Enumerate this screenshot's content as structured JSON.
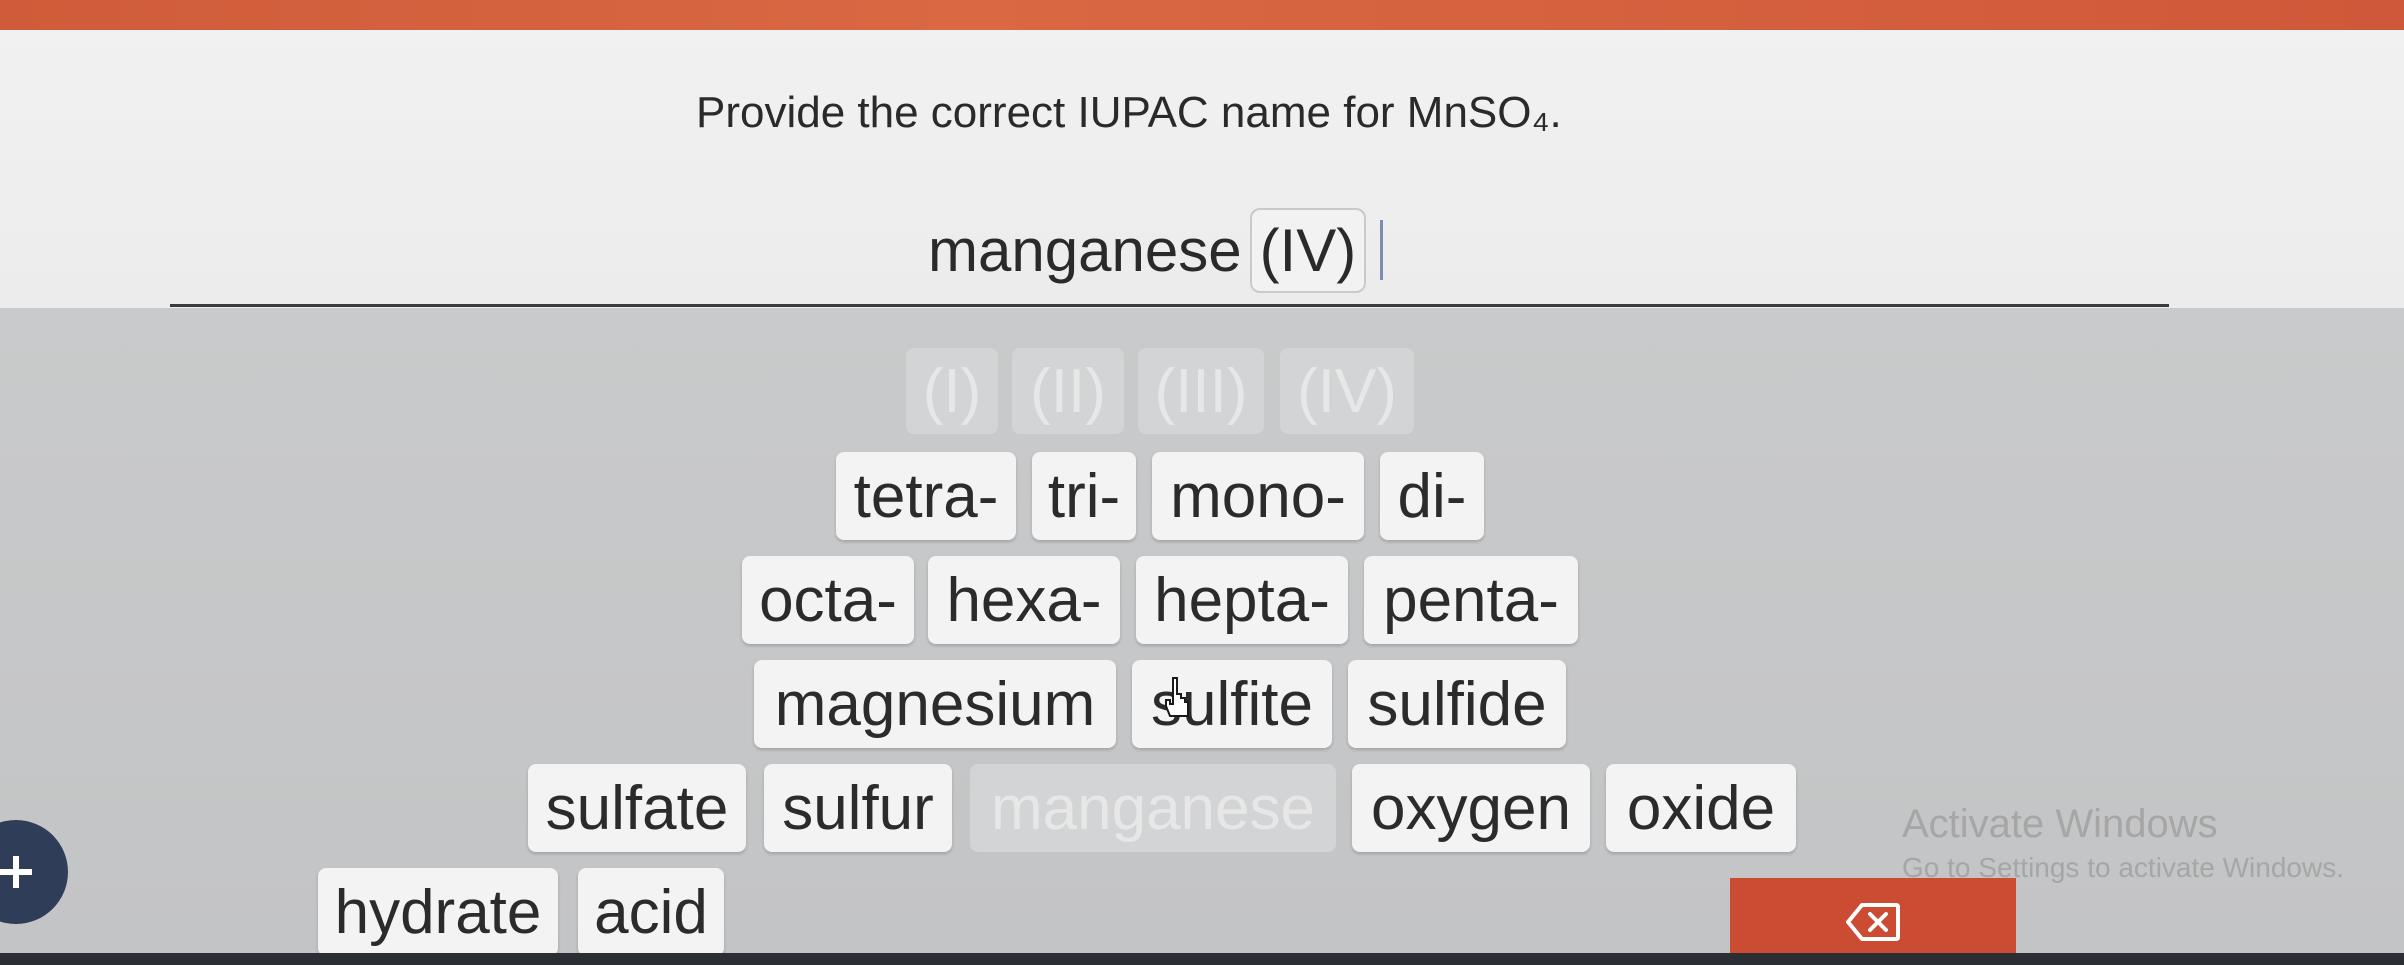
{
  "question": {
    "text": "Provide the correct IUPAC name for MnSO₄."
  },
  "answer": {
    "word": "manganese",
    "chip": "(IV)"
  },
  "roman_row": [
    "(I)",
    "(II)",
    "(III)",
    "(IV)"
  ],
  "prefix_row1": [
    "tetra-",
    "tri-",
    "mono-",
    "di-"
  ],
  "prefix_row2": [
    "octa-",
    "hexa-",
    "hepta-",
    "penta-"
  ],
  "word_row1": [
    "magnesium",
    "sulfite",
    "sulfide"
  ],
  "word_row2": [
    "sulfate",
    "sulfur",
    "manganese",
    "oxygen",
    "oxide"
  ],
  "word_row3": [
    "hydrate",
    "acid"
  ],
  "disabled_keys": [
    "(I)",
    "(II)",
    "(III)",
    "(IV)",
    "manganese"
  ],
  "watermark": {
    "title": "Activate Windows",
    "subtitle": "Go to Settings to activate Windows."
  },
  "icons": {
    "add": "plus-icon",
    "delete": "backspace-icon",
    "cursor": "hand-pointer-icon"
  },
  "colors": {
    "accent": "#cc4b33",
    "top_bar": "#d4603e",
    "plus_button": "#2f3d58"
  }
}
